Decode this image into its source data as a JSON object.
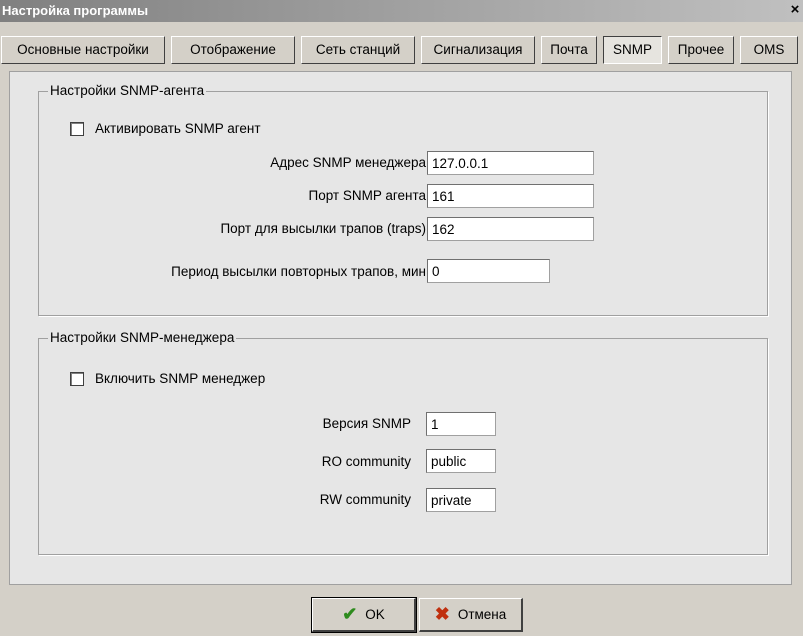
{
  "window": {
    "title": "Настройка программы",
    "close_glyph": "×"
  },
  "tabs": [
    {
      "label": "Основные настройки"
    },
    {
      "label": "Отображение"
    },
    {
      "label": "Сеть станций"
    },
    {
      "label": "Сигнализация"
    },
    {
      "label": "Почта"
    },
    {
      "label": "SNMP"
    },
    {
      "label": "Прочее"
    },
    {
      "label": "OMS"
    }
  ],
  "active_tab": "SNMP",
  "agent": {
    "group_title": "Настройки SNMP-агента",
    "enable_label": "Активировать SNMP агент",
    "enabled": false,
    "fields": [
      {
        "label": "Адрес SNMP менеджера",
        "value": "127.0.0.1"
      },
      {
        "label": "Порт SNMP агента",
        "value": "161"
      },
      {
        "label": "Порт для высылки трапов (traps)",
        "value": "162"
      },
      {
        "label": "Период высылки повторных трапов, мин",
        "value": "0"
      }
    ]
  },
  "manager": {
    "group_title": "Настройки SNMP-менеджера",
    "enable_label": "Включить SNMP менеджер",
    "enabled": false,
    "fields": [
      {
        "label": "Версия SNMP",
        "value": "1"
      },
      {
        "label": "RO community",
        "value": "public"
      },
      {
        "label": "RW community",
        "value": "private"
      }
    ]
  },
  "buttons": {
    "ok_label": "OK",
    "cancel_label": "Отмена",
    "ok_icon": "checkmark-icon",
    "cancel_icon": "x-icon"
  },
  "colors": {
    "ok_icon": "#2e8b1e",
    "cancel_icon": "#c0300f"
  }
}
